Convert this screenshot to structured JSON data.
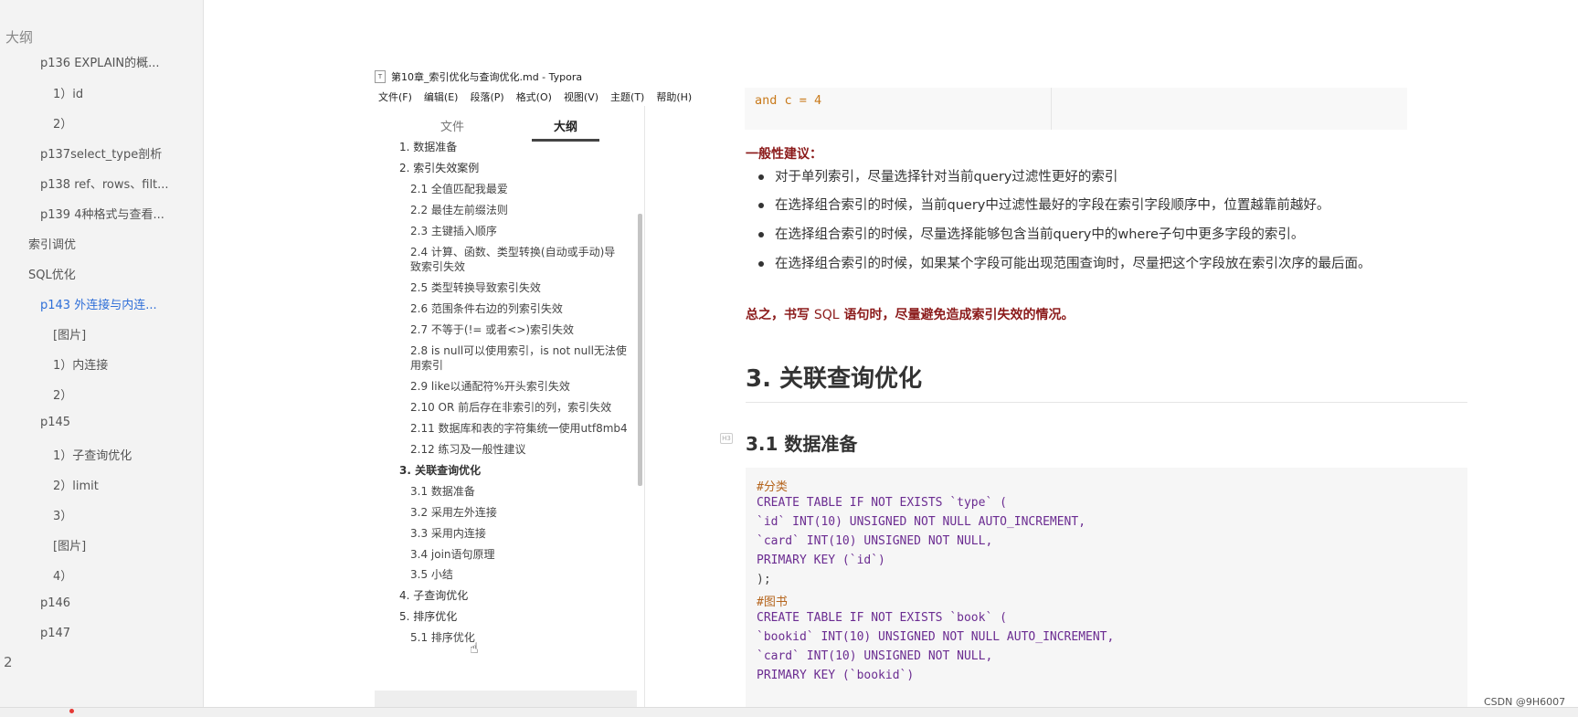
{
  "left_panel": {
    "title": "大纲",
    "items": [
      {
        "label": "p136 EXPLAIN的概..."
      },
      {
        "label": "1）id"
      },
      {
        "label": "2）"
      },
      {
        "label": "p137select_type剖析"
      },
      {
        "label": "p138 ref、rows、filt..."
      },
      {
        "label": "p139 4种格式与查看..."
      },
      {
        "label": "索引调优"
      },
      {
        "label": "SQL优化"
      },
      {
        "label": "p143 外连接与内连..."
      },
      {
        "label": "[图片]"
      },
      {
        "label": "1）内连接"
      },
      {
        "label": "2）"
      },
      {
        "label": "p145"
      },
      {
        "label": "1）子查询优化"
      },
      {
        "label": "2）limit"
      },
      {
        "label": "3）"
      },
      {
        "label": "[图片]"
      },
      {
        "label": "4）"
      },
      {
        "label": "p146"
      },
      {
        "label": "p147"
      }
    ],
    "bottom_number": "2"
  },
  "typora": {
    "title": "第10章_索引优化与查询优化.md - Typora",
    "menu": [
      "文件(F)",
      "编辑(E)",
      "段落(P)",
      "格式(O)",
      "视图(V)",
      "主题(T)",
      "帮助(H)"
    ],
    "sidebar": {
      "tab_files": "文件",
      "tab_outline": "大纲",
      "outline": [
        {
          "label": "1. 数据准备"
        },
        {
          "label": "2. 索引失效案例"
        },
        {
          "label": "2.1 全值匹配我最爱"
        },
        {
          "label": "2.2 最佳左前缀法则"
        },
        {
          "label": "2.3 主键插入顺序"
        },
        {
          "label": "2.4 计算、函数、类型转换(自动或手动)导"
        },
        {
          "label": "致索引失效"
        },
        {
          "label": "2.5 类型转换导致索引失效"
        },
        {
          "label": "2.6 范围条件右边的列索引失效"
        },
        {
          "label": "2.7 不等于(!= 或者<>)索引失效"
        },
        {
          "label": "2.8 is null可以使用索引，is not null无法使"
        },
        {
          "label": "用索引"
        },
        {
          "label": "2.9 like以通配符%开头索引失效"
        },
        {
          "label": "2.10 OR 前后存在非索引的列，索引失效"
        },
        {
          "label": "2.11 数据库和表的字符集统一使用utf8mb4"
        },
        {
          "label": "2.12 练习及一般性建议"
        },
        {
          "label": "3. 关联查询优化"
        },
        {
          "label": "3.1 数据准备"
        },
        {
          "label": "3.2 采用左外连接"
        },
        {
          "label": "3.3 采用内连接"
        },
        {
          "label": "3.4 join语句原理"
        },
        {
          "label": "3.5 小结"
        },
        {
          "label": "4. 子查询优化"
        },
        {
          "label": "5. 排序优化"
        },
        {
          "label": "5.1 排序优化"
        }
      ]
    },
    "editor": {
      "top_code": "and c =  4",
      "general_heading": "一般性建议：",
      "bullets": [
        "对于单列索引，尽量选择针对当前query过滤性更好的索引",
        "在选择组合索引的时候，当前query中过滤性最好的字段在索引字段顺序中，位置越靠前越好。",
        "在选择组合索引的时候，尽量选择能够包含当前query中的where子句中更多字段的索引。",
        "在选择组合索引的时候，如果某个字段可能出现范围查询时，尽量把这个字段放在索引次序的最后面。"
      ],
      "summary_pre": "总之，书写 ",
      "summary_sql": "SQL",
      "summary_post": " 语句时，尽量避免造成索引失效的情况。",
      "h2": "3. 关联查询优化",
      "h3": "3.1 数据准备",
      "code_lines": [
        "#分类",
        "CREATE TABLE IF NOT EXISTS `type` (",
        "`id` INT(10) UNSIGNED NOT NULL AUTO_INCREMENT,",
        "`card` INT(10) UNSIGNED NOT NULL,",
        "PRIMARY KEY (`id`)",
        ");",
        "#图书",
        "CREATE TABLE IF NOT EXISTS `book` (",
        "`bookid` INT(10) UNSIGNED NOT NULL AUTO_INCREMENT,",
        "`card` INT(10) UNSIGNED NOT NULL,",
        "PRIMARY KEY (`bookid`)"
      ]
    }
  },
  "watermark": "CSDN @9H6007",
  "colors": {
    "accent_blue": "#2f6fd8",
    "heading_red": "#8b1a1a",
    "code_orange": "#c97a1b",
    "code_purple": "#6b2c91"
  }
}
